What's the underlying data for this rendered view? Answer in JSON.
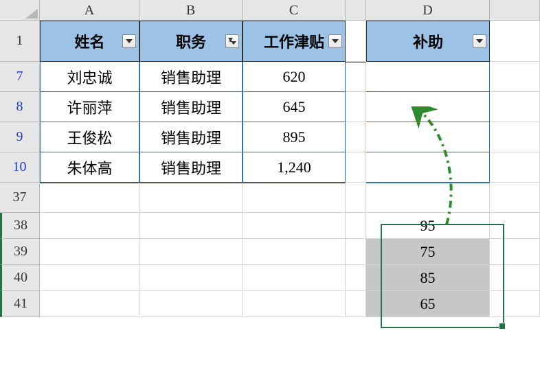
{
  "columns": [
    "A",
    "B",
    "C",
    "D"
  ],
  "header_row": "1",
  "data_row_numbers": [
    "7",
    "8",
    "9",
    "10"
  ],
  "gap_row": "37",
  "paste_row_numbers": [
    "38",
    "39",
    "40",
    "41"
  ],
  "headers": {
    "name": "姓名",
    "position": "职务",
    "allowance": "工作津贴",
    "subsidy": "补助"
  },
  "filters": {
    "name": false,
    "position": true,
    "allowance": false,
    "subsidy": false
  },
  "rows": [
    {
      "name": "刘忠诚",
      "position": "销售助理",
      "allowance": "620"
    },
    {
      "name": "许丽萍",
      "position": "销售助理",
      "allowance": "645"
    },
    {
      "name": "王俊松",
      "position": "销售助理",
      "allowance": "895"
    },
    {
      "name": "朱体高",
      "position": "销售助理",
      "allowance": "1,240"
    }
  ],
  "paste_values": [
    "95",
    "75",
    "85",
    "65"
  ],
  "chart_data": {
    "type": "table",
    "title": "",
    "columns": [
      "姓名",
      "职务",
      "工作津贴",
      "补助"
    ],
    "rows": [
      [
        "刘忠诚",
        "销售助理",
        620,
        null
      ],
      [
        "许丽萍",
        "销售助理",
        645,
        null
      ],
      [
        "王俊松",
        "销售助理",
        895,
        null
      ],
      [
        "朱体高",
        "销售助理",
        1240,
        null
      ]
    ],
    "clipboard_values_D38_D41": [
      95,
      75,
      85,
      65
    ]
  }
}
